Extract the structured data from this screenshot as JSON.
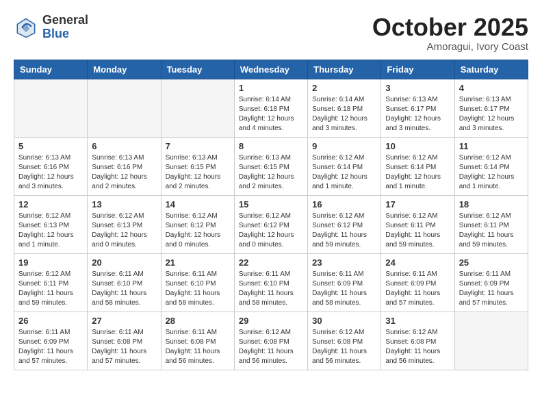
{
  "header": {
    "logo_general": "General",
    "logo_blue": "Blue",
    "month_title": "October 2025",
    "location": "Amoragui, Ivory Coast"
  },
  "weekdays": [
    "Sunday",
    "Monday",
    "Tuesday",
    "Wednesday",
    "Thursday",
    "Friday",
    "Saturday"
  ],
  "weeks": [
    [
      {
        "day": "",
        "empty": true
      },
      {
        "day": "",
        "empty": true
      },
      {
        "day": "",
        "empty": true
      },
      {
        "day": "1",
        "info": "Sunrise: 6:14 AM\nSunset: 6:18 PM\nDaylight: 12 hours\nand 4 minutes."
      },
      {
        "day": "2",
        "info": "Sunrise: 6:14 AM\nSunset: 6:18 PM\nDaylight: 12 hours\nand 3 minutes."
      },
      {
        "day": "3",
        "info": "Sunrise: 6:13 AM\nSunset: 6:17 PM\nDaylight: 12 hours\nand 3 minutes."
      },
      {
        "day": "4",
        "info": "Sunrise: 6:13 AM\nSunset: 6:17 PM\nDaylight: 12 hours\nand 3 minutes."
      }
    ],
    [
      {
        "day": "5",
        "info": "Sunrise: 6:13 AM\nSunset: 6:16 PM\nDaylight: 12 hours\nand 3 minutes."
      },
      {
        "day": "6",
        "info": "Sunrise: 6:13 AM\nSunset: 6:16 PM\nDaylight: 12 hours\nand 2 minutes."
      },
      {
        "day": "7",
        "info": "Sunrise: 6:13 AM\nSunset: 6:15 PM\nDaylight: 12 hours\nand 2 minutes."
      },
      {
        "day": "8",
        "info": "Sunrise: 6:13 AM\nSunset: 6:15 PM\nDaylight: 12 hours\nand 2 minutes."
      },
      {
        "day": "9",
        "info": "Sunrise: 6:12 AM\nSunset: 6:14 PM\nDaylight: 12 hours\nand 1 minute."
      },
      {
        "day": "10",
        "info": "Sunrise: 6:12 AM\nSunset: 6:14 PM\nDaylight: 12 hours\nand 1 minute."
      },
      {
        "day": "11",
        "info": "Sunrise: 6:12 AM\nSunset: 6:14 PM\nDaylight: 12 hours\nand 1 minute."
      }
    ],
    [
      {
        "day": "12",
        "info": "Sunrise: 6:12 AM\nSunset: 6:13 PM\nDaylight: 12 hours\nand 1 minute."
      },
      {
        "day": "13",
        "info": "Sunrise: 6:12 AM\nSunset: 6:13 PM\nDaylight: 12 hours\nand 0 minutes."
      },
      {
        "day": "14",
        "info": "Sunrise: 6:12 AM\nSunset: 6:12 PM\nDaylight: 12 hours\nand 0 minutes."
      },
      {
        "day": "15",
        "info": "Sunrise: 6:12 AM\nSunset: 6:12 PM\nDaylight: 12 hours\nand 0 minutes."
      },
      {
        "day": "16",
        "info": "Sunrise: 6:12 AM\nSunset: 6:12 PM\nDaylight: 11 hours\nand 59 minutes."
      },
      {
        "day": "17",
        "info": "Sunrise: 6:12 AM\nSunset: 6:11 PM\nDaylight: 11 hours\nand 59 minutes."
      },
      {
        "day": "18",
        "info": "Sunrise: 6:12 AM\nSunset: 6:11 PM\nDaylight: 11 hours\nand 59 minutes."
      }
    ],
    [
      {
        "day": "19",
        "info": "Sunrise: 6:12 AM\nSunset: 6:11 PM\nDaylight: 11 hours\nand 59 minutes."
      },
      {
        "day": "20",
        "info": "Sunrise: 6:11 AM\nSunset: 6:10 PM\nDaylight: 11 hours\nand 58 minutes."
      },
      {
        "day": "21",
        "info": "Sunrise: 6:11 AM\nSunset: 6:10 PM\nDaylight: 11 hours\nand 58 minutes."
      },
      {
        "day": "22",
        "info": "Sunrise: 6:11 AM\nSunset: 6:10 PM\nDaylight: 11 hours\nand 58 minutes."
      },
      {
        "day": "23",
        "info": "Sunrise: 6:11 AM\nSunset: 6:09 PM\nDaylight: 11 hours\nand 58 minutes."
      },
      {
        "day": "24",
        "info": "Sunrise: 6:11 AM\nSunset: 6:09 PM\nDaylight: 11 hours\nand 57 minutes."
      },
      {
        "day": "25",
        "info": "Sunrise: 6:11 AM\nSunset: 6:09 PM\nDaylight: 11 hours\nand 57 minutes."
      }
    ],
    [
      {
        "day": "26",
        "info": "Sunrise: 6:11 AM\nSunset: 6:09 PM\nDaylight: 11 hours\nand 57 minutes."
      },
      {
        "day": "27",
        "info": "Sunrise: 6:11 AM\nSunset: 6:08 PM\nDaylight: 11 hours\nand 57 minutes."
      },
      {
        "day": "28",
        "info": "Sunrise: 6:11 AM\nSunset: 6:08 PM\nDaylight: 11 hours\nand 56 minutes."
      },
      {
        "day": "29",
        "info": "Sunrise: 6:12 AM\nSunset: 6:08 PM\nDaylight: 11 hours\nand 56 minutes."
      },
      {
        "day": "30",
        "info": "Sunrise: 6:12 AM\nSunset: 6:08 PM\nDaylight: 11 hours\nand 56 minutes."
      },
      {
        "day": "31",
        "info": "Sunrise: 6:12 AM\nSunset: 6:08 PM\nDaylight: 11 hours\nand 56 minutes."
      },
      {
        "day": "",
        "empty": true
      }
    ]
  ]
}
